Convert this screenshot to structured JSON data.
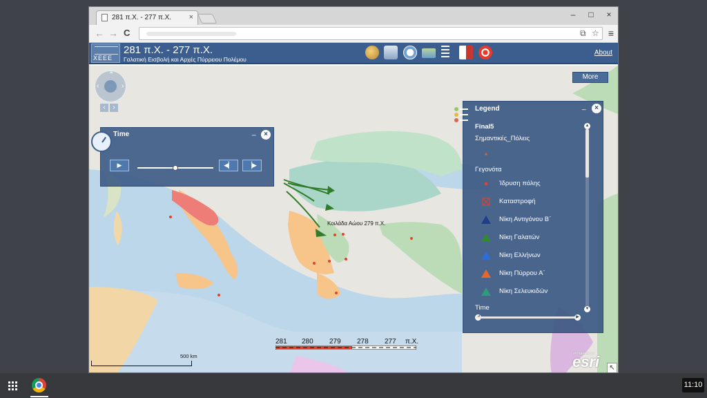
{
  "browser": {
    "tab_title": "281 π.Χ. - 277 π.Χ.",
    "tab_close": "×",
    "nav_back": "←",
    "nav_forward": "→",
    "nav_reload": "C",
    "window_min": "–",
    "window_max": "□",
    "window_close": "×",
    "menu": "≡"
  },
  "app": {
    "logo_text": "XEEE",
    "title": "281 π.Χ. - 277 π.Χ.",
    "subtitle": "Γαλατική Εισβολή και  Αρχές Πύρρειου Πολέμου",
    "about": "About",
    "tools": [
      "palette-icon",
      "print-icon",
      "time-icon",
      "basemap-icon",
      "legend-icon",
      "bookmark-icon",
      "target-icon"
    ]
  },
  "map": {
    "more_button": "More",
    "place_label": "Κοιλάδα Αώου 279 π.Χ.",
    "scale_label": "500 km",
    "esri_small": "POWERED BY",
    "esri_label": "esri",
    "timebar": {
      "years": [
        "281",
        "280",
        "279",
        "278",
        "277"
      ],
      "unit": "π.Χ."
    },
    "colors": {
      "sea": "#bcd6ea",
      "land": "#efece7",
      "green_kingdom": "#bcdcb8",
      "teal_kingdom": "#a9d6c9",
      "orange_region": "#f7c48a",
      "red_region": "#ee7d78",
      "arrow": "#2f7d2a"
    }
  },
  "time_panel": {
    "title": "Time",
    "minimize": "_",
    "close": "×",
    "play": "▶",
    "prev": "◀▏",
    "next": "▕▶",
    "slider_position": 0.5
  },
  "legend": {
    "title": "Legend",
    "minimize": "_",
    "close": "×",
    "layer": "Final5",
    "section_cities": "Σημαντικές_Πόλεις",
    "section_events": "Γεγονότα",
    "items": [
      {
        "label": "Ίδρυση πόλης",
        "symbol": "dot-red"
      },
      {
        "label": "Καταστροφή",
        "symbol": "cross-box"
      },
      {
        "label": "Νίκη Αντιγόνου Β΄",
        "symbol": "triangle-navy",
        "color": "#1d3e8c"
      },
      {
        "label": "Νίκη Γαλατών",
        "symbol": "triangle-green",
        "color": "#2f8a2f"
      },
      {
        "label": "Νίκη Ελλήνων",
        "symbol": "triangle-blue",
        "color": "#2a6fe0"
      },
      {
        "label": "Νίκη Πύρρου Α΄",
        "symbol": "triangle-orange",
        "color": "#e5672a"
      },
      {
        "label": "Νίκη Σελευκιδών",
        "symbol": "triangle-teal",
        "color": "#2c9c7a"
      }
    ],
    "section_time": "Time"
  },
  "taskbar": {
    "clock": "11:10"
  }
}
